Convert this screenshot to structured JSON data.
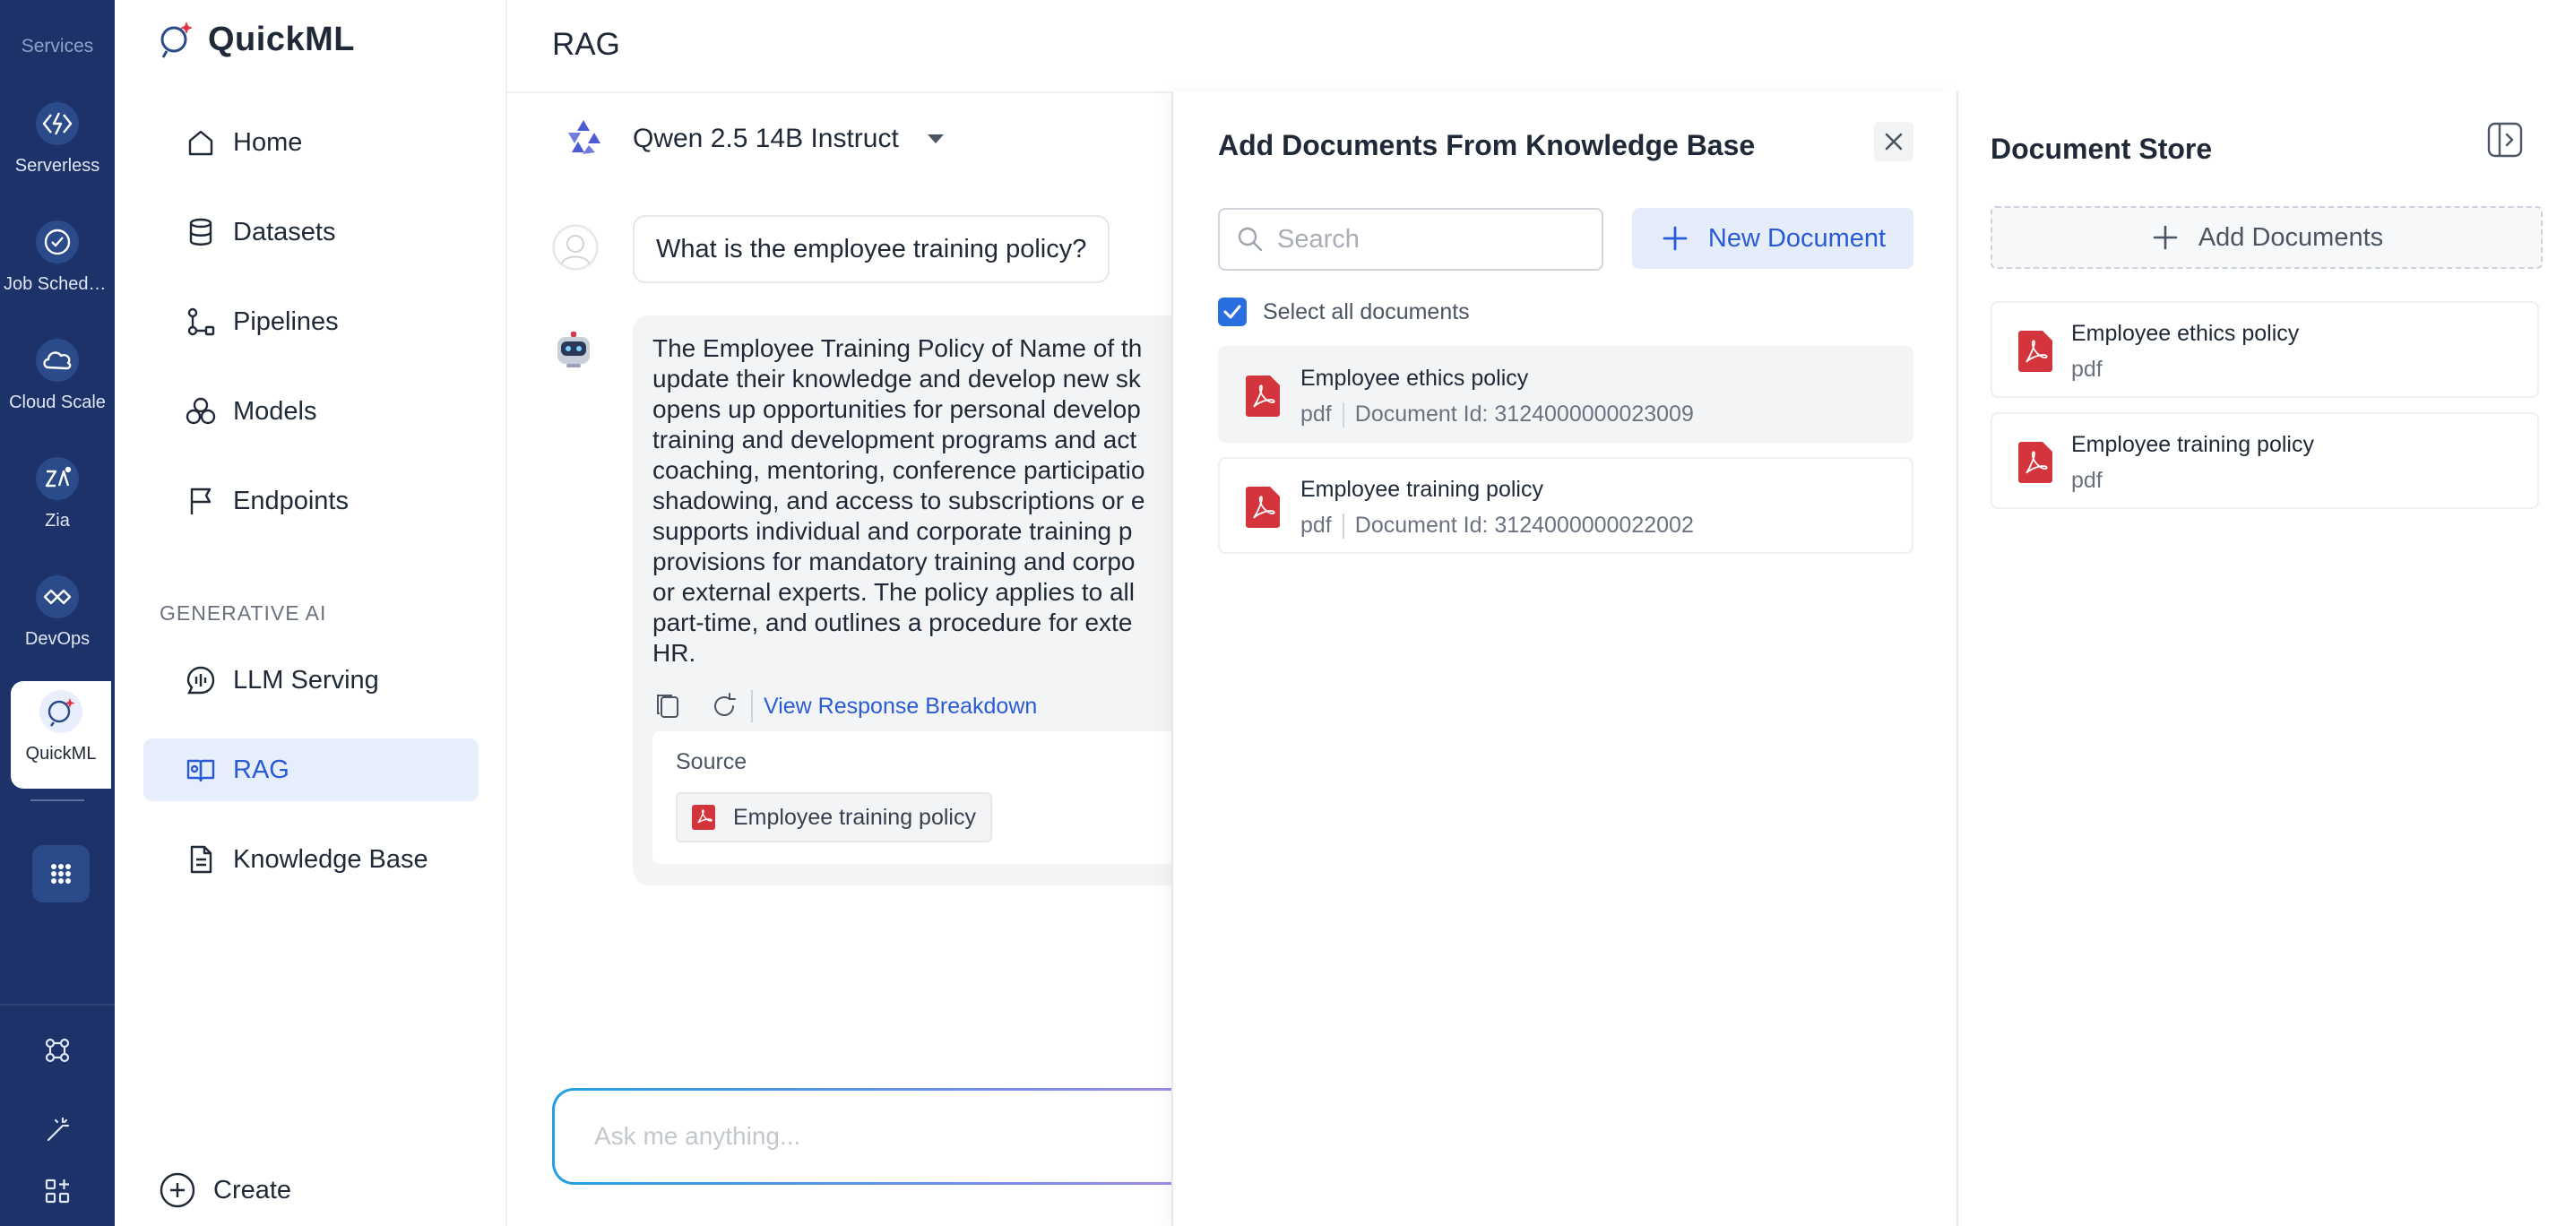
{
  "rail": {
    "title": "Services",
    "services": [
      {
        "label": "Serverless",
        "icon": "serverless-icon"
      },
      {
        "label": "Job Scheduling",
        "icon": "job-scheduling-icon"
      },
      {
        "label": "Cloud Scale",
        "icon": "cloud-scale-icon"
      },
      {
        "label": "Zia",
        "icon": "zia-icon"
      },
      {
        "label": "DevOps",
        "icon": "devops-icon"
      },
      {
        "label": "QuickML",
        "icon": "quickml-icon",
        "active": true
      }
    ]
  },
  "nav": {
    "brand": "QuickML",
    "items": [
      {
        "label": "Home",
        "icon": "home-icon"
      },
      {
        "label": "Datasets",
        "icon": "database-icon"
      },
      {
        "label": "Pipelines",
        "icon": "pipeline-icon"
      },
      {
        "label": "Models",
        "icon": "models-icon"
      },
      {
        "label": "Endpoints",
        "icon": "flag-icon"
      }
    ],
    "section_header": "GENERATIVE AI",
    "gen_items": [
      {
        "label": "LLM Serving",
        "icon": "llm-serving-icon"
      },
      {
        "label": "RAG",
        "icon": "rag-icon",
        "active": true
      },
      {
        "label": "Knowledge Base",
        "icon": "document-icon"
      }
    ],
    "create_label": "Create"
  },
  "main": {
    "title": "RAG",
    "model_name": "Qwen 2.5 14B Instruct",
    "user_message": "What is the employee training policy?",
    "bot_lines": [
      "The Employee Training Policy of Name of th",
      "update their knowledge and develop new sk",
      "opens up opportunities for personal develop",
      "training and development programs and act",
      "coaching, mentoring, conference participatio",
      "shadowing, and access to subscriptions or e",
      "supports individual and corporate training p",
      "provisions for mandatory training and corpo",
      "or external experts. The policy applies to all",
      "part-time, and outlines a procedure for exte",
      "HR."
    ],
    "view_breakdown": "View Response Breakdown",
    "source_label": "Source",
    "source_doc": "Employee training policy",
    "ask_placeholder": "Ask me anything..."
  },
  "kb_panel": {
    "title": "Add Documents From Knowledge Base",
    "search_placeholder": "Search",
    "new_document": "New Document",
    "select_all": "Select all documents",
    "documents": [
      {
        "name": "Employee ethics policy",
        "type": "pdf",
        "doc_id": "Document Id: 3124000000023009"
      },
      {
        "name": "Employee training policy",
        "type": "pdf",
        "doc_id": "Document Id: 3124000000022002"
      }
    ]
  },
  "store": {
    "title": "Document Store",
    "add_documents": "Add Documents",
    "documents": [
      {
        "name": "Employee ethics policy",
        "type": "pdf"
      },
      {
        "name": "Employee training policy",
        "type": "pdf"
      }
    ]
  },
  "colors": {
    "rail_bg": "#1c3268",
    "accent": "#2a5bd7",
    "pdf_red": "#d4343b"
  }
}
